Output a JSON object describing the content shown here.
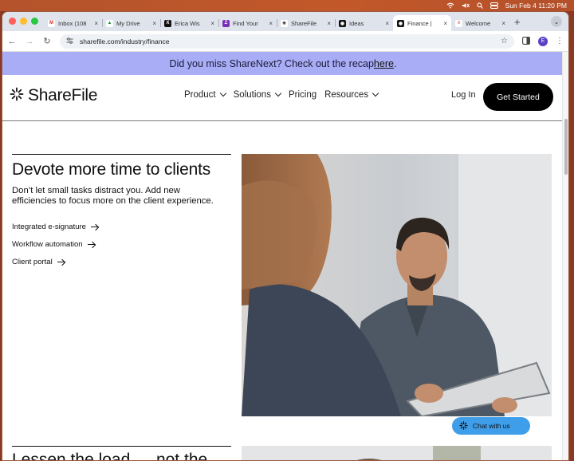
{
  "menubar": {
    "datetime": "Sun Feb 4  11:20 PM"
  },
  "tabs": [
    {
      "label": "Inbox (108",
      "fav": "gmail-favicon",
      "color": "#ffffff"
    },
    {
      "label": "My Drive",
      "fav": "drive-favicon",
      "color": "#ffffff"
    },
    {
      "label": "Erica Wis",
      "fav": "x-favicon",
      "color": "#111111"
    },
    {
      "label": "Find Your",
      "fav": "z-favicon",
      "color": "#7a2fb8"
    },
    {
      "label": "ShareFile",
      "fav": "sharefile-favicon",
      "color": "#ffffff"
    },
    {
      "label": "Ideas",
      "fav": "ideas-favicon",
      "color": "#111111"
    },
    {
      "label": "Finance |",
      "fav": "finance-favicon",
      "color": "#111111",
      "active": true
    },
    {
      "label": "Welcome",
      "fav": "flag-favicon",
      "color": "#ffffff"
    }
  ],
  "addressbar": {
    "url": "sharefile.com/industry/finance",
    "profile_initial": "E"
  },
  "banner": {
    "text": "Did you miss ShareNext? Check out the recap ",
    "link": "here",
    "end": "."
  },
  "nav": {
    "logo": "ShareFile",
    "links": [
      {
        "label": "Product",
        "dropdown": true
      },
      {
        "label": "Solutions",
        "dropdown": true
      },
      {
        "label": "Pricing",
        "dropdown": false
      },
      {
        "label": "Resources",
        "dropdown": true
      }
    ],
    "login": "Log In",
    "cta": "Get Started"
  },
  "hero": {
    "title": "Devote more time to clients",
    "description": "Don’t let small tasks distract you. Add new efficiencies to focus more on the client experience.",
    "features": [
      "Integrated e-signature",
      "Workflow automation",
      "Client portal"
    ]
  },
  "chat": {
    "label": "Chat with us"
  },
  "section2": {
    "title": "Lessen the load … not the"
  },
  "colors": {
    "banner": "#a8adf5",
    "cta": "#000000",
    "chat": "#3e9eea"
  }
}
